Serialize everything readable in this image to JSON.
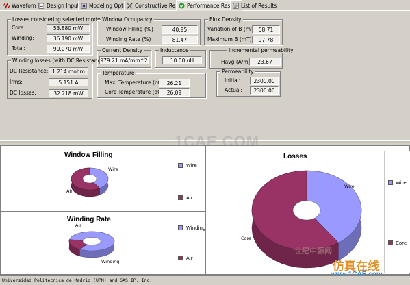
{
  "tabs": [
    {
      "label": "Waveforms",
      "icon": "waveform-icon"
    },
    {
      "label": "Design Inputs",
      "icon": "design-inputs-icon"
    },
    {
      "label": "Modeling Options",
      "icon": "modeling-options-icon"
    },
    {
      "label": "Constructive Results",
      "icon": "tools-icon"
    },
    {
      "label": "Performance Results",
      "icon": "performance-check-icon"
    },
    {
      "label": "List of Results",
      "icon": "list-icon"
    }
  ],
  "active_tab": "Performance Results",
  "losses_selected": {
    "title": "Losses considering selected model",
    "core_label": "Core:",
    "core_value": "53.880 mW",
    "winding_label": "Winding:",
    "winding_value": "36.190 mW",
    "total_label": "Total:",
    "total_value": "90.070 mW"
  },
  "winding_losses_dc": {
    "title": "Winding losses (with DC Resistance)",
    "dc_resistance_label": "DC Resistance:",
    "dc_resistance_value": "1.214 mohm",
    "irms_label": "Irms:",
    "irms_value": "5.151 A",
    "dc_losses_label": "DC losses:",
    "dc_losses_value": "32.218 mW"
  },
  "window_occupancy": {
    "title": "Window Occupancy",
    "filling_label": "Window Filling (%)",
    "filling_value": "40.95",
    "rate_label": "Winding Rate (%)",
    "rate_value": "81.47"
  },
  "flux_density": {
    "title": "Flux Density",
    "variation_label": "Variation of B (mT)",
    "variation_value": "58.71",
    "max_label": "Maximum B (mT)",
    "max_value": "97.78"
  },
  "current_density": {
    "title": "Current Density",
    "value": "979.21 mA/mm^2"
  },
  "inductance": {
    "title": "Inductance",
    "value": "10.00 uH"
  },
  "incremental_permeability": {
    "title": "Incremental permeability",
    "havg_label": "Havg (A/m):",
    "havg_value": "23.67"
  },
  "permeability": {
    "title": "Permeability",
    "initial_label": "Initial:",
    "initial_value": "2300.00",
    "actual_label": "Actual:",
    "actual_value": "2300.00"
  },
  "temperature": {
    "title": "Temperature",
    "max_label": "Max. Temperature (oC)",
    "max_value": "26.21",
    "core_label": "Core Temperature (oC)",
    "core_value": "26.09"
  },
  "colors": {
    "series_a": "#9999ff",
    "series_b": "#993366"
  },
  "chart_data": [
    {
      "type": "pie",
      "title": "Window Filling",
      "categories": [
        "Wire",
        "Air"
      ],
      "values": [
        40.95,
        59.05
      ],
      "legend": "right"
    },
    {
      "type": "pie",
      "title": "Winding Rate",
      "categories": [
        "Winding",
        "Air"
      ],
      "values": [
        81.47,
        18.53
      ],
      "legend": "right"
    },
    {
      "type": "pie",
      "title": "Losses",
      "categories": [
        "Wire",
        "Core"
      ],
      "values": [
        36.19,
        53.88
      ],
      "legend": "right"
    }
  ],
  "status_text": "Universidad Politecnica de Madrid (UPM) and SAS IP, Inc.",
  "watermarks": {
    "center": "1CAE.COM",
    "bottom_small": "世纪中源网",
    "bottom_cn": "仿真在线",
    "bottom_url": "www.1CAE.com"
  }
}
